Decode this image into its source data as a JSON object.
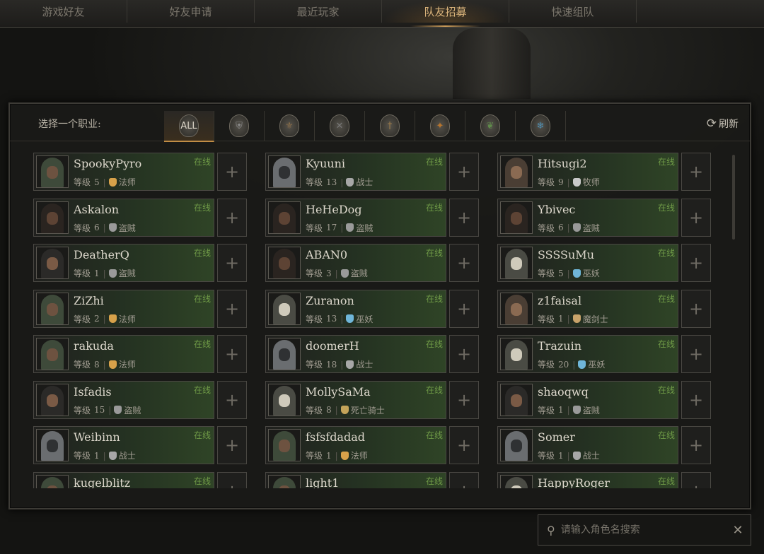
{
  "tabs": [
    {
      "label": "游戏好友",
      "active": false
    },
    {
      "label": "好友申请",
      "active": false
    },
    {
      "label": "最近玩家",
      "active": false
    },
    {
      "label": "队友招募",
      "active": true
    },
    {
      "label": "快速组队",
      "active": false
    }
  ],
  "class_filter": {
    "label": "选择一个职业:",
    "refresh_label": "刷新",
    "options": [
      {
        "name": "all",
        "text": "ALL",
        "active": true
      },
      {
        "name": "warrior",
        "text": "",
        "active": false
      },
      {
        "name": "rogue-crest",
        "text": "",
        "active": false
      },
      {
        "name": "rogue",
        "text": "",
        "active": false
      },
      {
        "name": "spellblade",
        "text": "",
        "active": false
      },
      {
        "name": "mage",
        "text": "",
        "active": false
      },
      {
        "name": "druid",
        "text": "",
        "active": false
      },
      {
        "name": "necromancer",
        "text": "",
        "active": false
      }
    ]
  },
  "level_prefix": "等级",
  "status_label": "在线",
  "class_colors": {
    "法师": "#d7a14a",
    "盗贼": "#9a9a9a",
    "战士": "#a7a7a7",
    "牧师": "#c9c9c9",
    "巫妖": "#6fb6d9",
    "魔剑士": "#c9a36a",
    "死亡骑士": "#c4a45a"
  },
  "players": [
    [
      {
        "name": "SpookyPyro",
        "level": "5",
        "class": "法师",
        "avatar": "hood"
      },
      {
        "name": "Askalon",
        "level": "6",
        "class": "盗贼",
        "avatar": "rogue"
      },
      {
        "name": "DeatherQ",
        "level": "1",
        "class": "盗贼",
        "avatar": "masked"
      },
      {
        "name": "ZiZhi",
        "level": "2",
        "class": "法师",
        "avatar": "hood"
      },
      {
        "name": "rakuda",
        "level": "8",
        "class": "法师",
        "avatar": "hood"
      },
      {
        "name": "Isfadis",
        "level": "15",
        "class": "盗贼",
        "avatar": "masked"
      },
      {
        "name": "Weibinn",
        "level": "1",
        "class": "战士",
        "avatar": "knight"
      },
      {
        "name": "kugelblitz",
        "level": "",
        "class": "",
        "avatar": "hood"
      }
    ],
    [
      {
        "name": "Kyuuni",
        "level": "13",
        "class": "战士",
        "avatar": "knight"
      },
      {
        "name": "HeHeDog",
        "level": "17",
        "class": "盗贼",
        "avatar": "rogue"
      },
      {
        "name": "ABAN0",
        "level": "3",
        "class": "盗贼",
        "avatar": "rogue"
      },
      {
        "name": "Zuranon",
        "level": "13",
        "class": "巫妖",
        "avatar": "skull"
      },
      {
        "name": "doomerH",
        "level": "18",
        "class": "战士",
        "avatar": "knight"
      },
      {
        "name": "MollySaMa",
        "level": "8",
        "class": "死亡骑士",
        "avatar": "skull"
      },
      {
        "name": "fsfsfdadad",
        "level": "1",
        "class": "法师",
        "avatar": "hood"
      },
      {
        "name": "light1",
        "level": "",
        "class": "",
        "avatar": "hood"
      }
    ],
    [
      {
        "name": "Hitsugi2",
        "level": "9",
        "class": "牧师",
        "avatar": "priest"
      },
      {
        "name": "Ybivec",
        "level": "6",
        "class": "盗贼",
        "avatar": "rogue"
      },
      {
        "name": "SSSSuMu",
        "level": "5",
        "class": "巫妖",
        "avatar": "skull"
      },
      {
        "name": "z1faisal",
        "level": "1",
        "class": "魔剑士",
        "avatar": "priest"
      },
      {
        "name": "Trazuin",
        "level": "20",
        "class": "巫妖",
        "avatar": "skull"
      },
      {
        "name": "shaoqwq",
        "level": "1",
        "class": "盗贼",
        "avatar": "masked"
      },
      {
        "name": "Somer",
        "level": "1",
        "class": "战士",
        "avatar": "knight"
      },
      {
        "name": "HappyRoger",
        "level": "",
        "class": "",
        "avatar": "skull"
      }
    ]
  ],
  "search": {
    "placeholder": "请输入角色名搜索",
    "value": ""
  }
}
